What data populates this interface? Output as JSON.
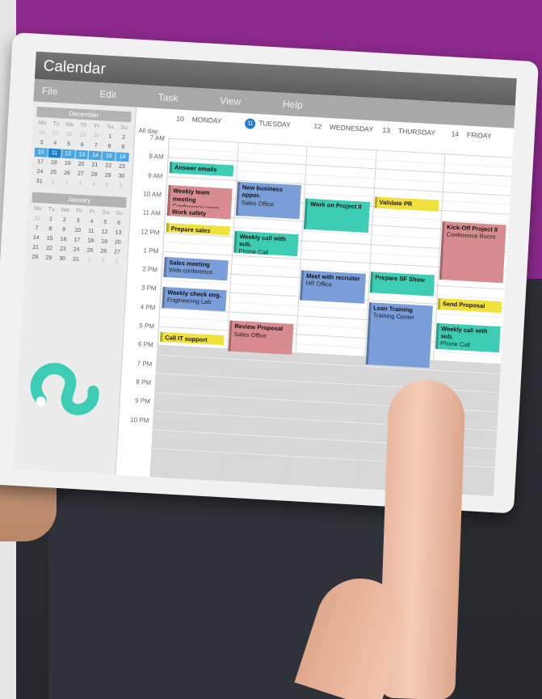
{
  "app": {
    "title": "Calendar"
  },
  "menu": [
    "File",
    "Edit",
    "Task",
    "View",
    "Help"
  ],
  "sidebar": {
    "dec": {
      "month": "December",
      "weekdays": [
        "Mo",
        "Tu",
        "We",
        "Th",
        "Fr",
        "Sa",
        "Su"
      ],
      "days": [
        "26",
        "27",
        "28",
        "29",
        "30",
        "1",
        "2",
        "3",
        "4",
        "5",
        "6",
        "7",
        "8",
        "9",
        "10",
        "11",
        "12",
        "13",
        "14",
        "15",
        "16",
        "17",
        "18",
        "19",
        "20",
        "21",
        "22",
        "23",
        "24",
        "25",
        "26",
        "27",
        "28",
        "29",
        "30",
        "31",
        "1",
        "2",
        "3",
        "4",
        "5",
        "6"
      ]
    },
    "jan": {
      "month": "January",
      "weekdays": [
        "Mo",
        "Tu",
        "We",
        "Th",
        "Fr",
        "Sa",
        "Su"
      ],
      "days": [
        "31",
        "1",
        "2",
        "3",
        "4",
        "5",
        "6",
        "7",
        "8",
        "9",
        "10",
        "11",
        "12",
        "13",
        "14",
        "15",
        "16",
        "17",
        "18",
        "19",
        "20",
        "21",
        "22",
        "23",
        "24",
        "25",
        "26",
        "27",
        "28",
        "29",
        "30",
        "31",
        "1",
        "2",
        "3"
      ]
    }
  },
  "days": [
    {
      "num": "10",
      "name": "MONDAY"
    },
    {
      "num": "11",
      "name": "TUESDAY"
    },
    {
      "num": "12",
      "name": "WEDNESDAY"
    },
    {
      "num": "13",
      "name": "THURSDAY"
    },
    {
      "num": "14",
      "name": "FRIDAY"
    }
  ],
  "allday_label": "All day",
  "hours": [
    "7 AM",
    "8 AM",
    "9 AM",
    "10 AM",
    "11 AM",
    "12 PM",
    "1 PM",
    "2 PM",
    "3 PM",
    "4 PM",
    "5 PM",
    "6 PM",
    "7 PM",
    "8 PM",
    "9 PM",
    "10 PM"
  ],
  "colors": {
    "teal": "#3dcdb5",
    "blue": "#7a9ed9",
    "pink": "#d88c8f",
    "yellow": "#f0e23a"
  },
  "events": [
    {
      "day": 0,
      "start": 8.25,
      "end": 8.85,
      "title": "Answer emails",
      "sub": "",
      "color": "teal"
    },
    {
      "day": 0,
      "start": 9.5,
      "end": 10.6,
      "title": "Weekly team meeting",
      "sub": "Conference room",
      "color": "pink"
    },
    {
      "day": 0,
      "start": 10.6,
      "end": 11.1,
      "title": "Work safety updates",
      "sub": "",
      "color": "pink"
    },
    {
      "day": 0,
      "start": 11.5,
      "end": 12.0,
      "title": "Prepare sales meet.",
      "sub": "",
      "color": "yellow"
    },
    {
      "day": 0,
      "start": 13.3,
      "end": 14.4,
      "title": "Sales meeting",
      "sub": "Web conference",
      "color": "blue"
    },
    {
      "day": 0,
      "start": 14.9,
      "end": 16.0,
      "title": "Weekly check eng.",
      "sub": "Engineering Lab",
      "color": "blue"
    },
    {
      "day": 0,
      "start": 17.3,
      "end": 17.8,
      "title": "Call IT support",
      "sub": "",
      "color": "yellow"
    },
    {
      "day": 1,
      "start": 9.1,
      "end": 10.9,
      "title": "New business oppor.",
      "sub": "Sales Office",
      "color": "blue"
    },
    {
      "day": 1,
      "start": 11.7,
      "end": 12.9,
      "title": "Weekly call with sub.",
      "sub": "Phone Call",
      "color": "teal"
    },
    {
      "day": 1,
      "start": 16.5,
      "end": 18.1,
      "title": "Review Proposal",
      "sub": "Sales Office",
      "color": "pink"
    },
    {
      "day": 2,
      "start": 9.8,
      "end": 11.4,
      "title": "Work on Project II",
      "sub": "",
      "color": "teal"
    },
    {
      "day": 2,
      "start": 13.6,
      "end": 15.2,
      "title": "Meet with recruiter",
      "sub": "HR Office",
      "color": "blue"
    },
    {
      "day": 3,
      "start": 9.5,
      "end": 10.1,
      "title": "Validate PR process",
      "sub": "",
      "color": "yellow"
    },
    {
      "day": 3,
      "start": 13.5,
      "end": 14.6,
      "title": "Prepare SF Show",
      "sub": "",
      "color": "teal"
    },
    {
      "day": 3,
      "start": 15.1,
      "end": 18.4,
      "title": "Lean Training",
      "sub": "Training Center",
      "color": "blue"
    },
    {
      "day": 4,
      "start": 10.6,
      "end": 13.7,
      "title": "Kick-Off Project II",
      "sub": "Conference Room",
      "color": "pink"
    },
    {
      "day": 4,
      "start": 14.7,
      "end": 15.3,
      "title": "Send Proposal",
      "sub": "",
      "color": "yellow"
    },
    {
      "day": 4,
      "start": 16.0,
      "end": 17.4,
      "title": "Weekly call with sub.",
      "sub": "Phone Call",
      "color": "teal"
    }
  ]
}
